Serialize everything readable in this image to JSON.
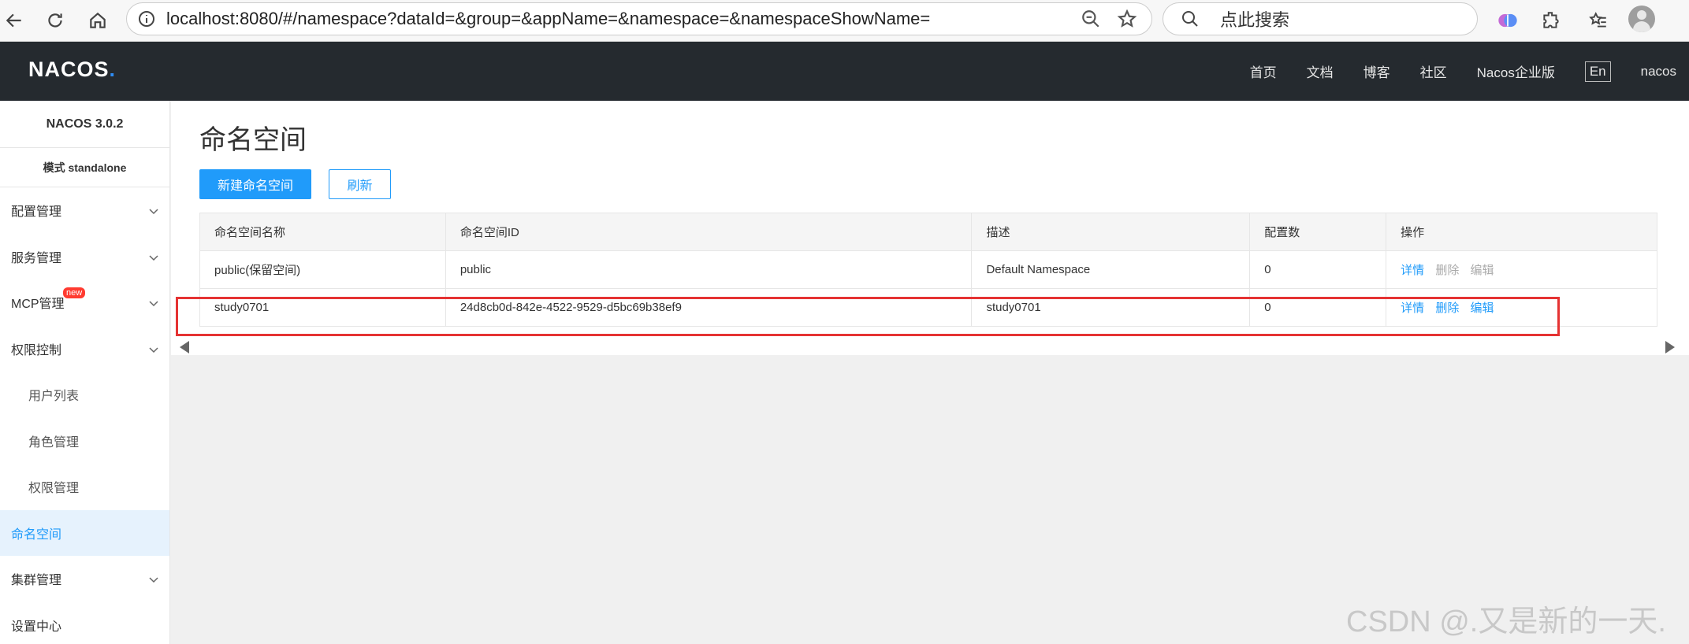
{
  "browser": {
    "url": "localhost:8080/#/namespace?dataId=&group=&appName=&namespace=&namespaceShowName=",
    "search_placeholder": "点此搜索"
  },
  "header": {
    "logo": "NACOS",
    "logo_dot": ".",
    "nav": [
      "首页",
      "文档",
      "博客",
      "社区",
      "Nacos企业版"
    ],
    "lang": "En",
    "user": "nacos"
  },
  "sidebar": {
    "version": "NACOS 3.0.2",
    "mode": "模式 standalone",
    "items": [
      {
        "label": "配置管理"
      },
      {
        "label": "服务管理"
      },
      {
        "label": "MCP管理",
        "badge": "new"
      },
      {
        "label": "权限控制"
      },
      {
        "label": "用户列表"
      },
      {
        "label": "角色管理"
      },
      {
        "label": "权限管理"
      },
      {
        "label": "命名空间"
      },
      {
        "label": "集群管理"
      },
      {
        "label": "设置中心"
      }
    ]
  },
  "main": {
    "title": "命名空间",
    "create_label": "新建命名空间",
    "refresh_label": "刷新",
    "columns": [
      "命名空间名称",
      "命名空间ID",
      "描述",
      "配置数",
      "操作"
    ],
    "rows": [
      {
        "name": "public(保留空间)",
        "id": "public",
        "desc": "Default Namespace",
        "count": "0",
        "ops": [
          "详情",
          "删除",
          "编辑"
        ]
      },
      {
        "name": "study0701",
        "id": "24d8cb0d-842e-4522-9529-d5bc69b38ef9",
        "desc": "study0701",
        "count": "0",
        "ops": [
          "详情",
          "删除",
          "编辑"
        ]
      }
    ]
  },
  "watermark": "CSDN @.又是新的一天.",
  "colors": {
    "accent": "#209bfa",
    "header_bg": "#252a2f",
    "highlight": "#e53333"
  }
}
